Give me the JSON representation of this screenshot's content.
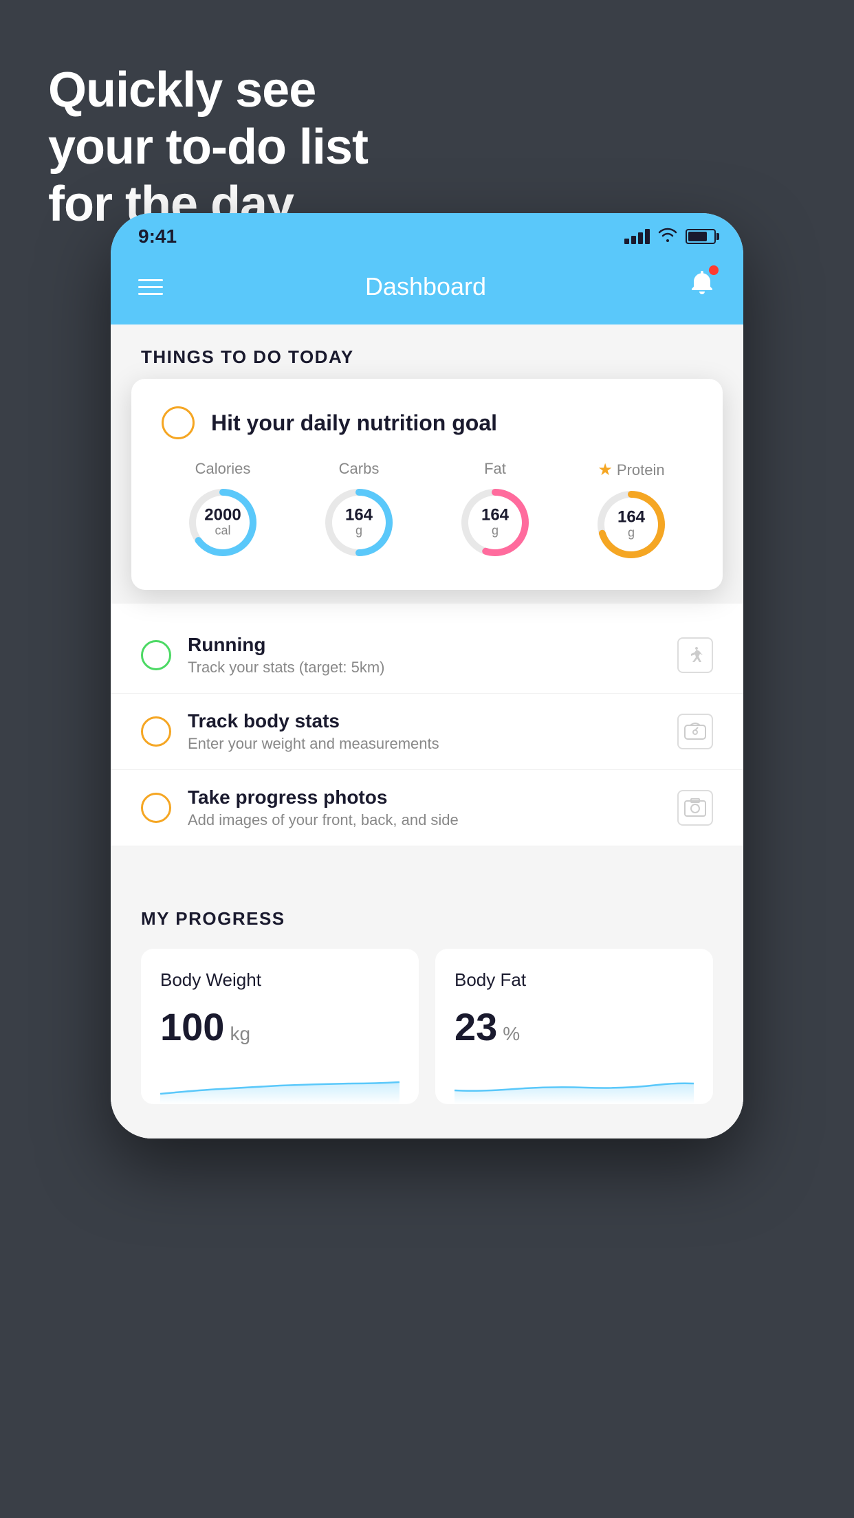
{
  "headline": {
    "line1": "Quickly see",
    "line2": "your to-do list",
    "line3": "for the day."
  },
  "statusBar": {
    "time": "9:41"
  },
  "appHeader": {
    "title": "Dashboard"
  },
  "thingsToDo": {
    "sectionTitle": "THINGS TO DO TODAY",
    "nutritionCard": {
      "checkboxColor": "yellow",
      "title": "Hit your daily nutrition goal",
      "stats": [
        {
          "label": "Calories",
          "starred": false,
          "value": "2000",
          "unit": "cal",
          "color": "blue",
          "pct": 65
        },
        {
          "label": "Carbs",
          "starred": false,
          "value": "164",
          "unit": "g",
          "color": "blue",
          "pct": 50
        },
        {
          "label": "Fat",
          "starred": false,
          "value": "164",
          "unit": "g",
          "color": "pink",
          "pct": 55
        },
        {
          "label": "Protein",
          "starred": true,
          "value": "164",
          "unit": "g",
          "color": "yellow",
          "pct": 70
        }
      ]
    },
    "todoItems": [
      {
        "id": "running",
        "checkboxColor": "green",
        "title": "Running",
        "subtitle": "Track your stats (target: 5km)",
        "icon": "shoe"
      },
      {
        "id": "body-stats",
        "checkboxColor": "yellow",
        "title": "Track body stats",
        "subtitle": "Enter your weight and measurements",
        "icon": "scale"
      },
      {
        "id": "photos",
        "checkboxColor": "yellow",
        "title": "Take progress photos",
        "subtitle": "Add images of your front, back, and side",
        "icon": "photo"
      }
    ]
  },
  "myProgress": {
    "sectionTitle": "MY PROGRESS",
    "cards": [
      {
        "title": "Body Weight",
        "value": "100",
        "unit": "kg"
      },
      {
        "title": "Body Fat",
        "value": "23",
        "unit": "%"
      }
    ]
  }
}
